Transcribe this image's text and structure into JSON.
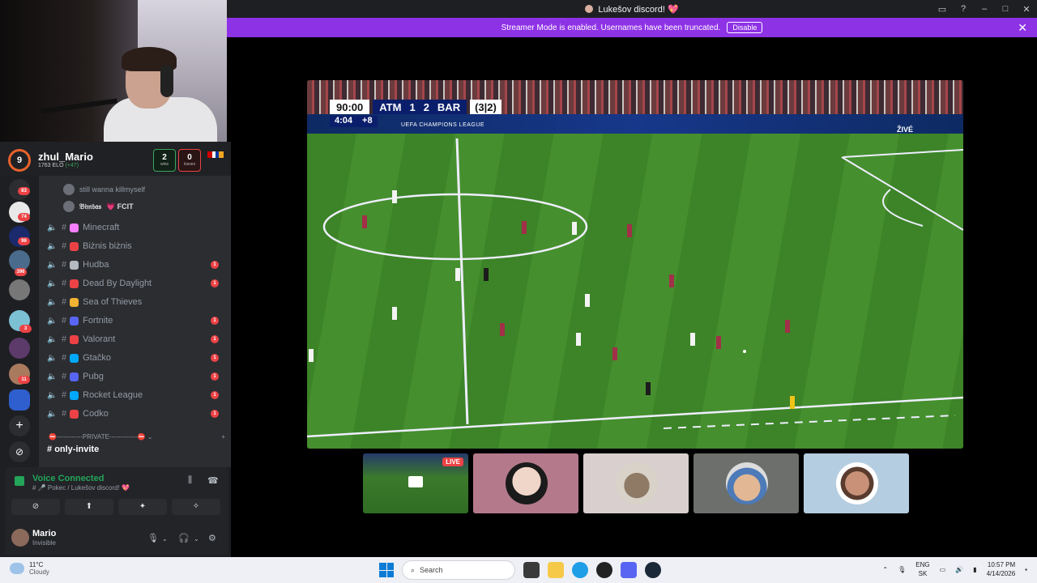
{
  "window": {
    "title": "Lukešov discord! 💖",
    "controls": [
      "▭",
      "?",
      "–",
      "□",
      "✕"
    ]
  },
  "banner": {
    "text": "Streamer Mode is enabled. Usernames have been truncated.",
    "disable_label": "Disable",
    "close": "✕"
  },
  "broadcast": {
    "time": "90:00",
    "team_home": "ATM",
    "score_home": "1",
    "score_away": "2",
    "team_away": "BAR",
    "aggregate": "(3|2)",
    "added_time": "4:04",
    "extra": "+8",
    "competition": "UEFA CHAMPIONS LEAGUE",
    "live_channel": "ŽIVÉ"
  },
  "thumbnails": {
    "live_badge": "LIVE"
  },
  "profile": {
    "level": "9",
    "name": "zhul_Mario",
    "elo": "1763 ELO",
    "elo_change": "(+47)",
    "wins": "2",
    "wins_label": "wins",
    "losses": "0",
    "losses_label": "losses"
  },
  "guild_badges": [
    "83",
    "74",
    "96",
    "396",
    "3",
    "11"
  ],
  "voice_users": [
    {
      "name": "still wanna killmyself",
      "tag": ""
    },
    {
      "name": "𝔅𝔦𝔪𝔟𝔞𝔰",
      "tag": "💗 FCIT"
    }
  ],
  "channels": [
    {
      "name": "Minecraft",
      "emoji_color": "#f47fff",
      "badge": ""
    },
    {
      "name": "Biżnis biżnis",
      "emoji_color": "#ed4245",
      "badge": ""
    },
    {
      "name": "Hudba",
      "emoji_color": "#b5bac1",
      "badge": "1"
    },
    {
      "name": "Dead By Daylight",
      "emoji_color": "#ed4245",
      "badge": "1"
    },
    {
      "name": "Sea of Thieves",
      "emoji_color": "#f0b232",
      "badge": ""
    },
    {
      "name": "Fortnite",
      "emoji_color": "#5865f2",
      "badge": "1"
    },
    {
      "name": "Valorant",
      "emoji_color": "#ed4245",
      "badge": "1"
    },
    {
      "name": "Gtačko",
      "emoji_color": "#00a8fc",
      "badge": "1"
    },
    {
      "name": "Pubg",
      "emoji_color": "#5865f2",
      "badge": "1"
    },
    {
      "name": "Rocket League",
      "emoji_color": "#00a8fc",
      "badge": "1"
    },
    {
      "name": "Codko",
      "emoji_color": "#ed4245",
      "badge": "1"
    }
  ],
  "category": {
    "label": "⛔------------PRIVATE-------------⛔ ⌄",
    "add": "+"
  },
  "text_channel": "only-invite",
  "voice": {
    "status": "Voice Connected",
    "location": "# 🎤 Pokec / Lukešov discord! 💖",
    "buttons": [
      "⊘",
      "⬆",
      "✦",
      "✧"
    ]
  },
  "user": {
    "name": "Mario",
    "status": "Invisible"
  },
  "taskbar": {
    "temp": "11°C",
    "weather": "Cloudy",
    "search_placeholder": "Search",
    "lang_top": "ENG",
    "lang_bottom": "SK",
    "time": "10:57 PM",
    "date": "4/14/2026"
  }
}
